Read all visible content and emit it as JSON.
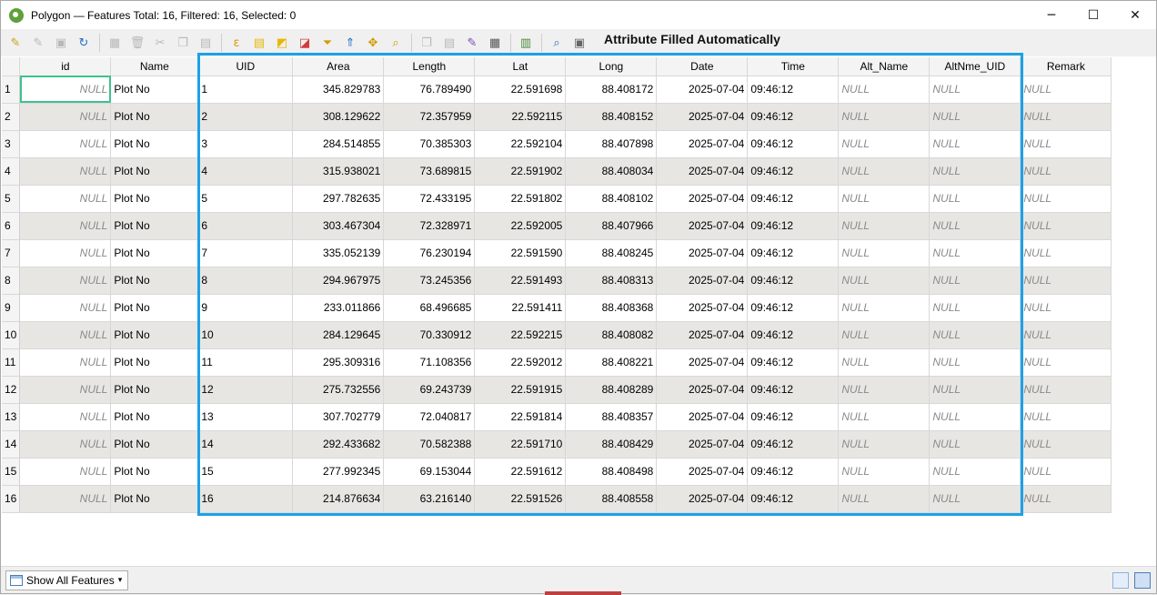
{
  "window": {
    "title": "Polygon — Features Total: 16, Filtered: 16, Selected: 0",
    "controls": {
      "minimize": "─",
      "maximize": "☐",
      "close": "✕"
    }
  },
  "toolbar": {
    "annotation": "Attribute Filled Automatically",
    "icons": [
      {
        "name": "toggle-editing-icon",
        "glyph": "✎",
        "dim": false,
        "color": "#c9a21a"
      },
      {
        "name": "multi-edit-icon",
        "glyph": "✎",
        "dim": true
      },
      {
        "name": "save-edits-icon",
        "glyph": "▣",
        "dim": true
      },
      {
        "name": "reload-icon",
        "glyph": "↻",
        "dim": false,
        "color": "#2a6fc9"
      },
      {
        "sep": true
      },
      {
        "name": "add-feature-icon",
        "glyph": "▦",
        "dim": true
      },
      {
        "name": "delete-feature-icon",
        "glyph": "🗑",
        "dim": true
      },
      {
        "name": "cut-icon",
        "glyph": "✂",
        "dim": true
      },
      {
        "name": "copy-icon",
        "glyph": "❐",
        "dim": true
      },
      {
        "name": "paste-icon",
        "glyph": "▤",
        "dim": true
      },
      {
        "sep": true
      },
      {
        "name": "select-expression-icon",
        "glyph": "ε",
        "dim": false,
        "color": "#d49a00"
      },
      {
        "name": "select-all-icon",
        "glyph": "▤",
        "dim": false,
        "color": "#e8b800"
      },
      {
        "name": "invert-selection-icon",
        "glyph": "◩",
        "dim": false,
        "color": "#e8b800"
      },
      {
        "name": "deselect-all-icon",
        "glyph": "◪",
        "dim": false,
        "color": "#d43a3a"
      },
      {
        "name": "filter-icon",
        "glyph": "⏷",
        "dim": false,
        "color": "#d49a00"
      },
      {
        "name": "move-selection-top-icon",
        "glyph": "⇑",
        "dim": false,
        "color": "#2a6fc9"
      },
      {
        "name": "pan-to-selection-icon",
        "glyph": "✥",
        "dim": false,
        "color": "#d49a00"
      },
      {
        "name": "zoom-to-selection-icon",
        "glyph": "⌕",
        "dim": false,
        "color": "#d49a00"
      },
      {
        "sep": true
      },
      {
        "name": "copy-rows-icon",
        "glyph": "❐",
        "dim": true
      },
      {
        "name": "paste-rows-icon",
        "glyph": "▤",
        "dim": true
      },
      {
        "name": "new-field-icon",
        "glyph": "✎",
        "dim": false,
        "color": "#7a4bb0"
      },
      {
        "name": "field-calculator-icon",
        "glyph": "▦",
        "dim": false,
        "color": "#555"
      },
      {
        "sep": true
      },
      {
        "name": "conditional-formatting-icon",
        "glyph": "▥",
        "dim": false,
        "color": "#4a8a3a"
      },
      {
        "sep": true
      },
      {
        "name": "dock-table-icon",
        "glyph": "⌕",
        "dim": false,
        "color": "#2a6fc9"
      },
      {
        "name": "actions-icon",
        "glyph": "▣",
        "dim": false,
        "color": "#666"
      }
    ]
  },
  "table": {
    "columns": [
      "id",
      "Name",
      "UID",
      "Area",
      "Length",
      "Lat",
      "Long",
      "Date",
      "Time",
      "Alt_Name",
      "AltNme_UID",
      "Remark"
    ],
    "rows": [
      {
        "n": "1",
        "id": "NULL",
        "name": "Plot No",
        "uid": "1",
        "area": "345.829783",
        "length": "76.789490",
        "lat": "22.591698",
        "long": "88.408172",
        "date": "2025-07-04",
        "time": "09:46:12",
        "alt_name": "NULL",
        "altnme_uid": "NULL",
        "remark": "NULL"
      },
      {
        "n": "2",
        "id": "NULL",
        "name": "Plot No",
        "uid": "2",
        "area": "308.129622",
        "length": "72.357959",
        "lat": "22.592115",
        "long": "88.408152",
        "date": "2025-07-04",
        "time": "09:46:12",
        "alt_name": "NULL",
        "altnme_uid": "NULL",
        "remark": "NULL"
      },
      {
        "n": "3",
        "id": "NULL",
        "name": "Plot No",
        "uid": "3",
        "area": "284.514855",
        "length": "70.385303",
        "lat": "22.592104",
        "long": "88.407898",
        "date": "2025-07-04",
        "time": "09:46:12",
        "alt_name": "NULL",
        "altnme_uid": "NULL",
        "remark": "NULL"
      },
      {
        "n": "4",
        "id": "NULL",
        "name": "Plot No",
        "uid": "4",
        "area": "315.938021",
        "length": "73.689815",
        "lat": "22.591902",
        "long": "88.408034",
        "date": "2025-07-04",
        "time": "09:46:12",
        "alt_name": "NULL",
        "altnme_uid": "NULL",
        "remark": "NULL"
      },
      {
        "n": "5",
        "id": "NULL",
        "name": "Plot No",
        "uid": "5",
        "area": "297.782635",
        "length": "72.433195",
        "lat": "22.591802",
        "long": "88.408102",
        "date": "2025-07-04",
        "time": "09:46:12",
        "alt_name": "NULL",
        "altnme_uid": "NULL",
        "remark": "NULL"
      },
      {
        "n": "6",
        "id": "NULL",
        "name": "Plot No",
        "uid": "6",
        "area": "303.467304",
        "length": "72.328971",
        "lat": "22.592005",
        "long": "88.407966",
        "date": "2025-07-04",
        "time": "09:46:12",
        "alt_name": "NULL",
        "altnme_uid": "NULL",
        "remark": "NULL"
      },
      {
        "n": "7",
        "id": "NULL",
        "name": "Plot No",
        "uid": "7",
        "area": "335.052139",
        "length": "76.230194",
        "lat": "22.591590",
        "long": "88.408245",
        "date": "2025-07-04",
        "time": "09:46:12",
        "alt_name": "NULL",
        "altnme_uid": "NULL",
        "remark": "NULL"
      },
      {
        "n": "8",
        "id": "NULL",
        "name": "Plot No",
        "uid": "8",
        "area": "294.967975",
        "length": "73.245356",
        "lat": "22.591493",
        "long": "88.408313",
        "date": "2025-07-04",
        "time": "09:46:12",
        "alt_name": "NULL",
        "altnme_uid": "NULL",
        "remark": "NULL"
      },
      {
        "n": "9",
        "id": "NULL",
        "name": "Plot No",
        "uid": "9",
        "area": "233.011866",
        "length": "68.496685",
        "lat": "22.591411",
        "long": "88.408368",
        "date": "2025-07-04",
        "time": "09:46:12",
        "alt_name": "NULL",
        "altnme_uid": "NULL",
        "remark": "NULL"
      },
      {
        "n": "10",
        "id": "NULL",
        "name": "Plot No",
        "uid": "10",
        "area": "284.129645",
        "length": "70.330912",
        "lat": "22.592215",
        "long": "88.408082",
        "date": "2025-07-04",
        "time": "09:46:12",
        "alt_name": "NULL",
        "altnme_uid": "NULL",
        "remark": "NULL"
      },
      {
        "n": "11",
        "id": "NULL",
        "name": "Plot No",
        "uid": "11",
        "area": "295.309316",
        "length": "71.108356",
        "lat": "22.592012",
        "long": "88.408221",
        "date": "2025-07-04",
        "time": "09:46:12",
        "alt_name": "NULL",
        "altnme_uid": "NULL",
        "remark": "NULL"
      },
      {
        "n": "12",
        "id": "NULL",
        "name": "Plot No",
        "uid": "12",
        "area": "275.732556",
        "length": "69.243739",
        "lat": "22.591915",
        "long": "88.408289",
        "date": "2025-07-04",
        "time": "09:46:12",
        "alt_name": "NULL",
        "altnme_uid": "NULL",
        "remark": "NULL"
      },
      {
        "n": "13",
        "id": "NULL",
        "name": "Plot No",
        "uid": "13",
        "area": "307.702779",
        "length": "72.040817",
        "lat": "22.591814",
        "long": "88.408357",
        "date": "2025-07-04",
        "time": "09:46:12",
        "alt_name": "NULL",
        "altnme_uid": "NULL",
        "remark": "NULL"
      },
      {
        "n": "14",
        "id": "NULL",
        "name": "Plot No",
        "uid": "14",
        "area": "292.433682",
        "length": "70.582388",
        "lat": "22.591710",
        "long": "88.408429",
        "date": "2025-07-04",
        "time": "09:46:12",
        "alt_name": "NULL",
        "altnme_uid": "NULL",
        "remark": "NULL"
      },
      {
        "n": "15",
        "id": "NULL",
        "name": "Plot No",
        "uid": "15",
        "area": "277.992345",
        "length": "69.153044",
        "lat": "22.591612",
        "long": "88.408498",
        "date": "2025-07-04",
        "time": "09:46:12",
        "alt_name": "NULL",
        "altnme_uid": "NULL",
        "remark": "NULL"
      },
      {
        "n": "16",
        "id": "NULL",
        "name": "Plot No",
        "uid": "16",
        "area": "214.876634",
        "length": "63.216140",
        "lat": "22.591526",
        "long": "88.408558",
        "date": "2025-07-04",
        "time": "09:46:12",
        "alt_name": "NULL",
        "altnme_uid": "NULL",
        "remark": "NULL"
      }
    ]
  },
  "statusbar": {
    "filter_button_label": "Show All Features"
  },
  "colors": {
    "highlight_box": "#1da1e6",
    "selected_cell_outline": "#3ec28f",
    "alt_row": "#e8e6e2"
  }
}
